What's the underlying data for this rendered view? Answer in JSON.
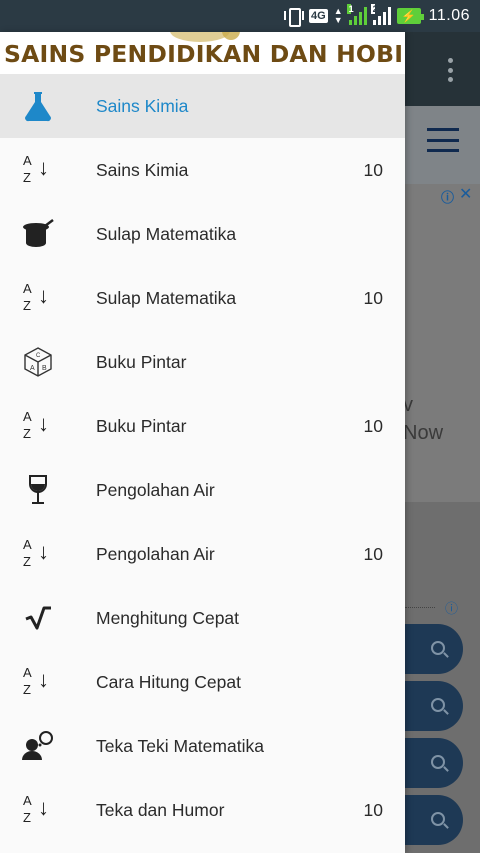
{
  "status_bar": {
    "network": "4G",
    "sim1_badge": "1",
    "sim2_badge": "2",
    "time": "11.06",
    "icons": [
      "vibrate-icon",
      "network-arrows-icon",
      "signal-icon",
      "signal-icon",
      "battery-charging-icon"
    ]
  },
  "drawer": {
    "header_title": "SAINS PENDIDIKAN DAN HOBI",
    "items": [
      {
        "label": "Sains Kimia",
        "count": "",
        "icon": "flask-icon",
        "active": true
      },
      {
        "label": "Sains Kimia",
        "count": "10",
        "icon": "sort-az-icon"
      },
      {
        "label": "Sulap Matematika",
        "count": "",
        "icon": "magic-hat-icon"
      },
      {
        "label": "Sulap Matematika",
        "count": "10",
        "icon": "sort-az-icon"
      },
      {
        "label": "Buku Pintar",
        "count": "",
        "icon": "alphabet-block-icon"
      },
      {
        "label": "Buku Pintar",
        "count": "10",
        "icon": "sort-az-icon"
      },
      {
        "label": "Pengolahan Air",
        "count": "",
        "icon": "wine-glass-icon"
      },
      {
        "label": "Pengolahan Air",
        "count": "10",
        "icon": "sort-az-icon"
      },
      {
        "label": "Menghitung Cepat",
        "count": "",
        "icon": "square-root-icon"
      },
      {
        "label": "Cara Hitung Cepat",
        "count": "",
        "icon": "sort-az-icon"
      },
      {
        "label": "Teka Teki Matematika",
        "count": "",
        "icon": "thinking-person-icon"
      },
      {
        "label": "Teka dan Humor",
        "count": "10",
        "icon": "sort-az-icon"
      }
    ],
    "sort_icon_text": {
      "a": "A",
      "z": "Z",
      "arrow": "↓"
    }
  },
  "background": {
    "ad_info": "ⓘ",
    "ad_close": "✕",
    "ad_text_1": "v",
    "ad_text_2": "Now",
    "info_icon": "ⓘ"
  },
  "colors": {
    "status_bar": "#2b3a44",
    "active_item_text": "#1e88c9",
    "active_item_bg": "#e6e6e6",
    "header_title": "#6e4b14",
    "flask": "#1e88c9"
  }
}
